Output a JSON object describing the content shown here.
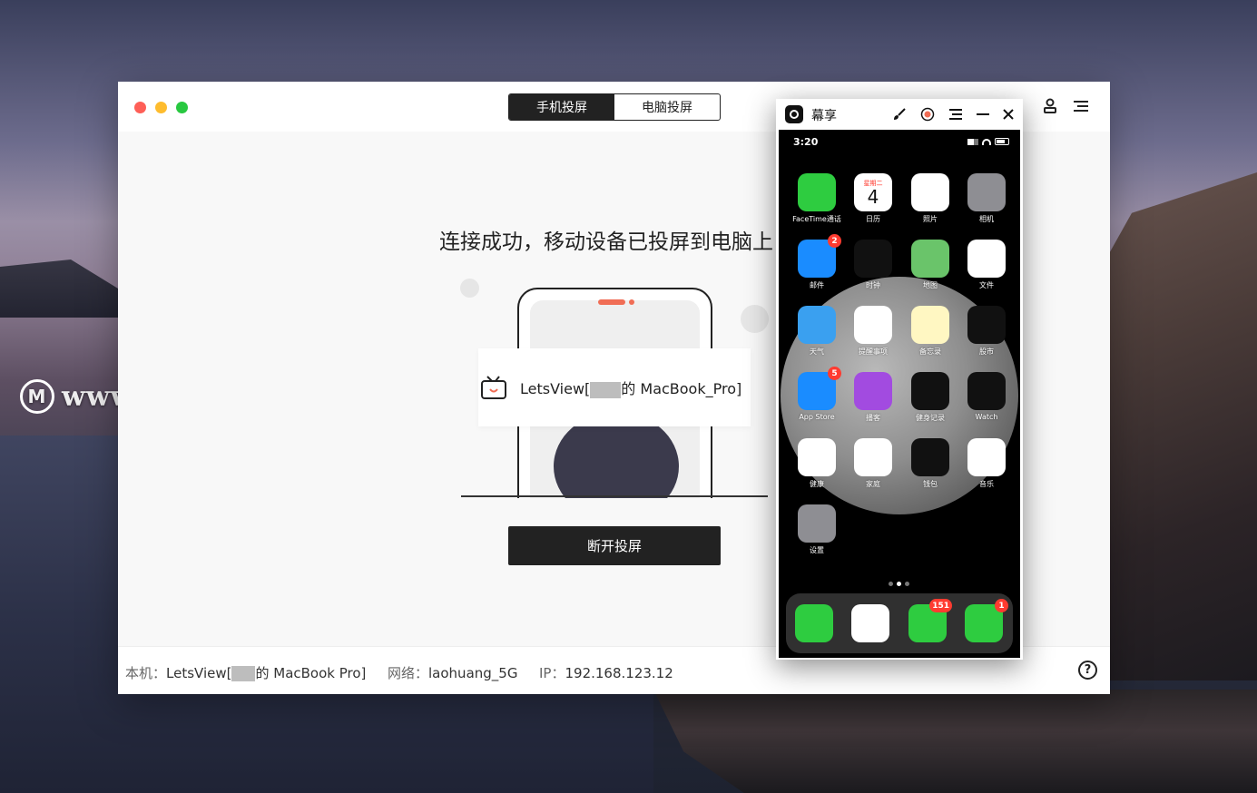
{
  "watermark": {
    "text": "www.MacZ.com"
  },
  "app": {
    "tabs": [
      {
        "label": "手机投屏",
        "active": true
      },
      {
        "label": "电脑投屏",
        "active": false
      }
    ],
    "headline": "连接成功，移动设备已投屏到电脑上",
    "device_card": {
      "prefix": "LetsView[",
      "suffix": "的 MacBook_Pro]"
    },
    "disconnect_label": "断开投屏",
    "status": {
      "local_label": "本机：",
      "local_prefix": "LetsView[",
      "local_suffix": "的 MacBook Pro]",
      "network_label": "网络：",
      "network_value": "laohuang_5G",
      "ip_label": "IP：",
      "ip_value": "192.168.123.12"
    },
    "help_symbol": "?"
  },
  "mirror": {
    "title": "幕享",
    "phone": {
      "time": "3:20",
      "apps": [
        {
          "label": "FaceTime通话",
          "icon": "facetime-icon",
          "color": "#2ecc40"
        },
        {
          "label": "日历",
          "icon": "calendar-icon",
          "color": "#ffffff",
          "text": "4",
          "sub": "星期二"
        },
        {
          "label": "照片",
          "icon": "photos-icon",
          "color": "#ffffff"
        },
        {
          "label": "相机",
          "icon": "camera-icon",
          "color": "#8e8e93"
        },
        {
          "label": "邮件",
          "icon": "mail-icon",
          "color": "#1a8cff",
          "badge": "2"
        },
        {
          "label": "时钟",
          "icon": "clock-icon",
          "color": "#111111"
        },
        {
          "label": "地图",
          "icon": "maps-icon",
          "color": "#6ac46a"
        },
        {
          "label": "文件",
          "icon": "files-icon",
          "color": "#ffffff"
        },
        {
          "label": "天气",
          "icon": "weather-icon",
          "color": "#3aa0f0"
        },
        {
          "label": "提醒事项",
          "icon": "reminders-icon",
          "color": "#ffffff"
        },
        {
          "label": "备忘录",
          "icon": "notes-icon",
          "color": "#fff7c2"
        },
        {
          "label": "股市",
          "icon": "stocks-icon",
          "color": "#111111"
        },
        {
          "label": "App Store",
          "icon": "appstore-icon",
          "color": "#1a8cff",
          "badge": "5"
        },
        {
          "label": "播客",
          "icon": "podcasts-icon",
          "color": "#a24be0"
        },
        {
          "label": "健身记录",
          "icon": "fitness-icon",
          "color": "#111111"
        },
        {
          "label": "Watch",
          "icon": "watch-icon",
          "color": "#111111"
        },
        {
          "label": "健康",
          "icon": "health-icon",
          "color": "#ffffff"
        },
        {
          "label": "家庭",
          "icon": "home-icon",
          "color": "#ffffff"
        },
        {
          "label": "钱包",
          "icon": "wallet-icon",
          "color": "#111111"
        },
        {
          "label": "音乐",
          "icon": "music-icon",
          "color": "#ffffff"
        },
        {
          "label": "设置",
          "icon": "settings-icon",
          "color": "#8e8e93"
        }
      ],
      "dock": [
        {
          "icon": "phone-icon",
          "color": "#2ecc40"
        },
        {
          "icon": "safari-icon",
          "color": "#ffffff"
        },
        {
          "icon": "messages-icon",
          "color": "#2ecc40",
          "badge": "151"
        },
        {
          "icon": "wechat-icon",
          "color": "#2ecc40",
          "badge": "1"
        }
      ]
    }
  }
}
